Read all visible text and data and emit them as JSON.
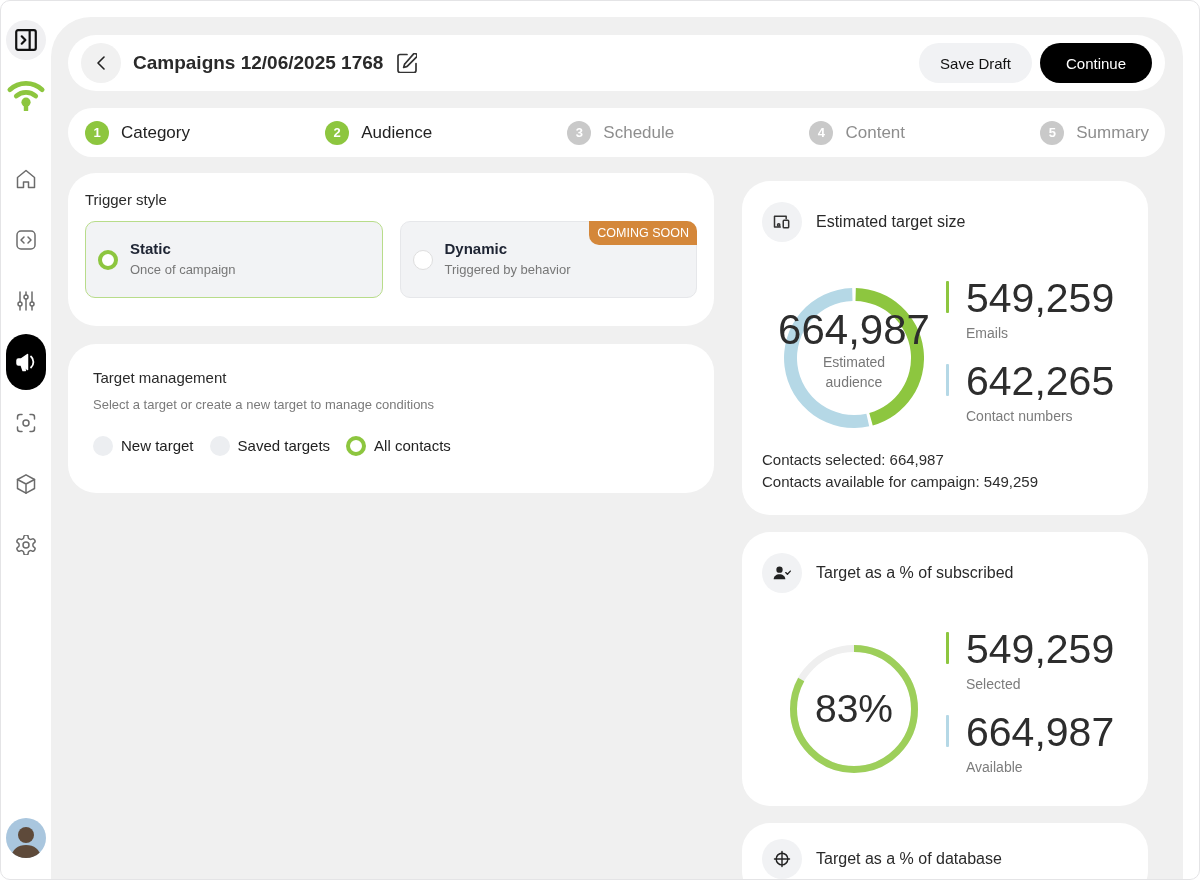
{
  "sidebar": {
    "nav_items": [
      {
        "selected": false
      },
      {
        "selected": false
      },
      {
        "selected": false
      },
      {
        "selected": true
      },
      {
        "selected": false
      },
      {
        "selected": false
      },
      {
        "selected": false
      }
    ]
  },
  "header": {
    "title": "Campaigns 12/06/2025 1768",
    "buttons": [
      {
        "label": "Save Draft",
        "kind": "secondary"
      },
      {
        "label": "Continue",
        "kind": "primary"
      }
    ]
  },
  "steps": [
    {
      "number": "1",
      "label": "Category",
      "active": true
    },
    {
      "number": "2",
      "label": "Audience",
      "active": true
    },
    {
      "number": "3",
      "label": "Schedule",
      "active": false
    },
    {
      "number": "4",
      "label": "Content",
      "active": false
    },
    {
      "number": "5",
      "label": "Summary",
      "active": false
    }
  ],
  "trigger_style": {
    "title": "Trigger style",
    "options": [
      {
        "title": "Static",
        "description": "Once of campaign",
        "selected": true
      },
      {
        "title": "Dynamic",
        "description": "Triggered by behavior",
        "selected": false,
        "badge": "COMING SOON"
      }
    ]
  },
  "target_management": {
    "title": "Target management",
    "subtitle": "Select a target or create a new target to manage conditions",
    "options": [
      {
        "label": "New target",
        "selected": false
      },
      {
        "label": "Saved targets",
        "selected": false
      },
      {
        "label": "All contacts",
        "selected": true
      }
    ]
  },
  "estimated_target_size": {
    "title": "Estimated target size",
    "center_value": "664,987",
    "center_label": "Estimated audience",
    "chart_data": {
      "type": "donut",
      "values": [
        46.1,
        53.9
      ]
    },
    "stats": [
      {
        "value": "549,259",
        "label": "Emails",
        "color": "#8dc63f"
      },
      {
        "value": "642,265",
        "label": "Contact numbers",
        "color": "#b5d8e6"
      }
    ],
    "notes": [
      "Contacts selected: 664,987",
      "Contacts available for campaign: 549,259"
    ]
  },
  "target_subscribed": {
    "title": "Target as a % of subscribed",
    "reading": "83%",
    "level": 0.83,
    "stats": [
      {
        "value": "549,259",
        "label": "Selected",
        "color": "#8dc63f"
      },
      {
        "value": "664,987",
        "label": "Available",
        "color": "#b5d8e6"
      }
    ]
  },
  "target_database": {
    "title": "Target as a % of database"
  }
}
